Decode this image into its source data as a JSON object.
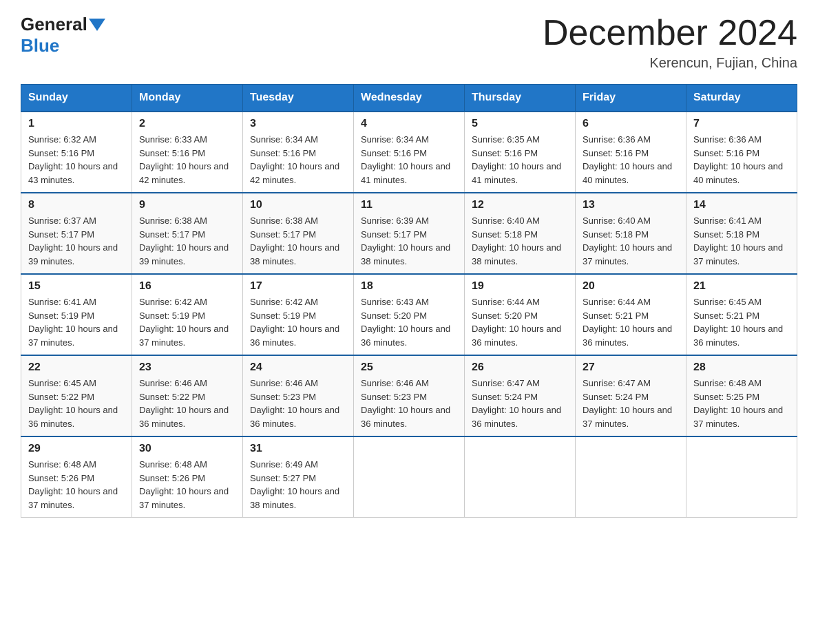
{
  "header": {
    "logo_general": "General",
    "logo_blue": "Blue",
    "month_year": "December 2024",
    "location": "Kerencun, Fujian, China"
  },
  "days_of_week": [
    "Sunday",
    "Monday",
    "Tuesday",
    "Wednesday",
    "Thursday",
    "Friday",
    "Saturday"
  ],
  "weeks": [
    [
      {
        "day": "1",
        "sunrise": "6:32 AM",
        "sunset": "5:16 PM",
        "daylight": "10 hours and 43 minutes."
      },
      {
        "day": "2",
        "sunrise": "6:33 AM",
        "sunset": "5:16 PM",
        "daylight": "10 hours and 42 minutes."
      },
      {
        "day": "3",
        "sunrise": "6:34 AM",
        "sunset": "5:16 PM",
        "daylight": "10 hours and 42 minutes."
      },
      {
        "day": "4",
        "sunrise": "6:34 AM",
        "sunset": "5:16 PM",
        "daylight": "10 hours and 41 minutes."
      },
      {
        "day": "5",
        "sunrise": "6:35 AM",
        "sunset": "5:16 PM",
        "daylight": "10 hours and 41 minutes."
      },
      {
        "day": "6",
        "sunrise": "6:36 AM",
        "sunset": "5:16 PM",
        "daylight": "10 hours and 40 minutes."
      },
      {
        "day": "7",
        "sunrise": "6:36 AM",
        "sunset": "5:16 PM",
        "daylight": "10 hours and 40 minutes."
      }
    ],
    [
      {
        "day": "8",
        "sunrise": "6:37 AM",
        "sunset": "5:17 PM",
        "daylight": "10 hours and 39 minutes."
      },
      {
        "day": "9",
        "sunrise": "6:38 AM",
        "sunset": "5:17 PM",
        "daylight": "10 hours and 39 minutes."
      },
      {
        "day": "10",
        "sunrise": "6:38 AM",
        "sunset": "5:17 PM",
        "daylight": "10 hours and 38 minutes."
      },
      {
        "day": "11",
        "sunrise": "6:39 AM",
        "sunset": "5:17 PM",
        "daylight": "10 hours and 38 minutes."
      },
      {
        "day": "12",
        "sunrise": "6:40 AM",
        "sunset": "5:18 PM",
        "daylight": "10 hours and 38 minutes."
      },
      {
        "day": "13",
        "sunrise": "6:40 AM",
        "sunset": "5:18 PM",
        "daylight": "10 hours and 37 minutes."
      },
      {
        "day": "14",
        "sunrise": "6:41 AM",
        "sunset": "5:18 PM",
        "daylight": "10 hours and 37 minutes."
      }
    ],
    [
      {
        "day": "15",
        "sunrise": "6:41 AM",
        "sunset": "5:19 PM",
        "daylight": "10 hours and 37 minutes."
      },
      {
        "day": "16",
        "sunrise": "6:42 AM",
        "sunset": "5:19 PM",
        "daylight": "10 hours and 37 minutes."
      },
      {
        "day": "17",
        "sunrise": "6:42 AM",
        "sunset": "5:19 PM",
        "daylight": "10 hours and 36 minutes."
      },
      {
        "day": "18",
        "sunrise": "6:43 AM",
        "sunset": "5:20 PM",
        "daylight": "10 hours and 36 minutes."
      },
      {
        "day": "19",
        "sunrise": "6:44 AM",
        "sunset": "5:20 PM",
        "daylight": "10 hours and 36 minutes."
      },
      {
        "day": "20",
        "sunrise": "6:44 AM",
        "sunset": "5:21 PM",
        "daylight": "10 hours and 36 minutes."
      },
      {
        "day": "21",
        "sunrise": "6:45 AM",
        "sunset": "5:21 PM",
        "daylight": "10 hours and 36 minutes."
      }
    ],
    [
      {
        "day": "22",
        "sunrise": "6:45 AM",
        "sunset": "5:22 PM",
        "daylight": "10 hours and 36 minutes."
      },
      {
        "day": "23",
        "sunrise": "6:46 AM",
        "sunset": "5:22 PM",
        "daylight": "10 hours and 36 minutes."
      },
      {
        "day": "24",
        "sunrise": "6:46 AM",
        "sunset": "5:23 PM",
        "daylight": "10 hours and 36 minutes."
      },
      {
        "day": "25",
        "sunrise": "6:46 AM",
        "sunset": "5:23 PM",
        "daylight": "10 hours and 36 minutes."
      },
      {
        "day": "26",
        "sunrise": "6:47 AM",
        "sunset": "5:24 PM",
        "daylight": "10 hours and 36 minutes."
      },
      {
        "day": "27",
        "sunrise": "6:47 AM",
        "sunset": "5:24 PM",
        "daylight": "10 hours and 37 minutes."
      },
      {
        "day": "28",
        "sunrise": "6:48 AM",
        "sunset": "5:25 PM",
        "daylight": "10 hours and 37 minutes."
      }
    ],
    [
      {
        "day": "29",
        "sunrise": "6:48 AM",
        "sunset": "5:26 PM",
        "daylight": "10 hours and 37 minutes."
      },
      {
        "day": "30",
        "sunrise": "6:48 AM",
        "sunset": "5:26 PM",
        "daylight": "10 hours and 37 minutes."
      },
      {
        "day": "31",
        "sunrise": "6:49 AM",
        "sunset": "5:27 PM",
        "daylight": "10 hours and 38 minutes."
      },
      null,
      null,
      null,
      null
    ]
  ]
}
